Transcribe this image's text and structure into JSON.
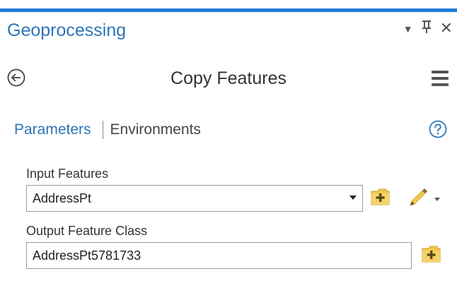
{
  "pane": {
    "title": "Geoprocessing",
    "controls": {
      "dropdown_glyph": "▼",
      "pin_glyph": "⫫",
      "close_glyph": "✕"
    }
  },
  "tool": {
    "title": "Copy Features"
  },
  "tabs": [
    {
      "label": "Parameters",
      "active": true
    },
    {
      "label": "Environments",
      "active": false
    }
  ],
  "parameters": {
    "input_features": {
      "label": "Input Features",
      "value": "AddressPt"
    },
    "output_feature_class": {
      "label": "Output Feature Class",
      "value": "AddressPt5781733"
    }
  },
  "icons": {
    "back": "back-arrow-icon",
    "menu": "hamburger-menu-icon",
    "help": "help-icon",
    "browse": "browse-folder-icon",
    "edit": "pencil-icon"
  },
  "colors": {
    "accent": "#1e7ed8",
    "title_blue": "#2e75b6",
    "folder_yellow": "#f2c94c"
  }
}
